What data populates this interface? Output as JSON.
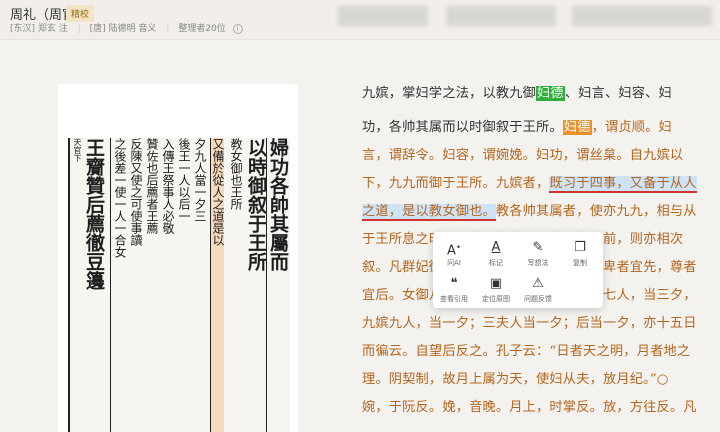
{
  "header": {
    "book_title": "周礼（周官）",
    "badge": "精校",
    "author1": "[东汉] 郑玄 注",
    "author2": "[唐] 陆德明 音义",
    "editors": "整理者20位",
    "info_icon": "info-icon"
  },
  "scan": {
    "side_label": "天官下",
    "columns": [
      {
        "text": "王齎贊后薦徹豆籩",
        "big": true
      },
      {
        "text": "之後差一使一人一合女",
        "big": false
      },
      {
        "text": "反陳又使之可使事讀",
        "big": false
      },
      {
        "text": "贊佐也后薦者王薦",
        "big": false
      },
      {
        "text": "入傳王祭事人必敬",
        "big": false
      },
      {
        "text": "後王一人以后一",
        "big": false
      },
      {
        "text": "夕九人當一夕三",
        "big": false
      },
      {
        "text": "又備於從人之道是以",
        "big": false
      },
      {
        "text": "教女御也王所",
        "big": false
      },
      {
        "text": "以時御叙于王所",
        "big": true
      },
      {
        "text": "婦功各帥其屬而",
        "big": true
      }
    ]
  },
  "text": {
    "l1": {
      "a": "九嫔，掌妇学之法，以教九御",
      "hl": "妇德",
      "b": "、妇言、妇容、妇"
    },
    "l2": {
      "a": "功，各帅其属而以时御叙于王所。",
      "hl": "妇德",
      "b": "，谓贞顺。妇"
    },
    "l3": "言，谓辞令。妇容，谓婉娩。妇功，谓丝枲。自九嫔以",
    "l4": {
      "a": "下，九九而御于王所。九嫔者，",
      "sel": "既习于四事，又备于从人"
    },
    "l5": {
      "sel": "之道，是以教女御也。",
      "b": "教各帅其属者，使亦九九，相与从"
    },
    "l6": "于王所息之时。而贵者宜先后，尊者宜居前，则亦相次",
    "l7": "叙。凡群妃御见之法，月与后妃其象也，卑者宜先，尊者",
    "l8": "宜后。女御八十一人，当九夕；世妇二十七人，当三夕，",
    "l9": "九嫔九人，当一夕；三夫人当一夕；后当一夕，亦十五日",
    "l10": "而徧云。自望后反之。孔子云：“日者天之明，月者地之",
    "l11": "理。阴契制，故月上属为天，使妇从夫，放月纪。”○",
    "l12": "婉，于阮反。娩，音晚。月上，时掌反。放，方往反。凡"
  },
  "popup": {
    "ask_ai": "问AI",
    "mark": "标记",
    "note": "写想法",
    "copy": "复制",
    "cite": "查看引用",
    "locate": "定位原图",
    "feedback": "问题反馈"
  }
}
